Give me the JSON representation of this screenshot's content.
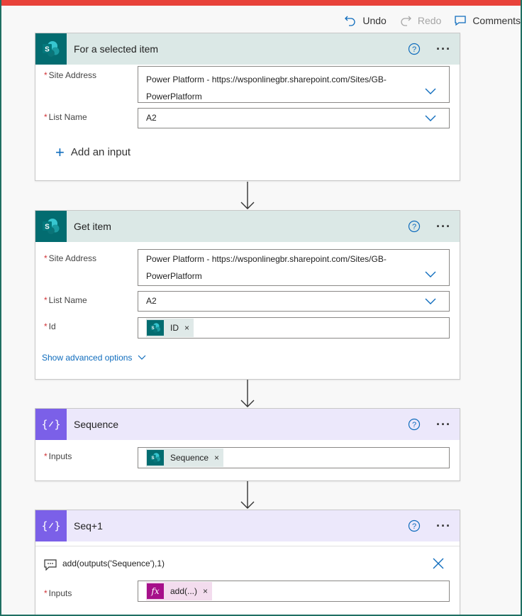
{
  "toolbar": {
    "undo_label": "Undo",
    "redo_label": "Redo",
    "comments_label": "Comments"
  },
  "cards": {
    "trigger": {
      "title": "For a selected item",
      "site_address_label": "Site Address",
      "site_address_line1": "Power Platform - https://wsponlinegbr.sharepoint.com/Sites/GB-",
      "site_address_line2": "PowerPlatform",
      "list_name_label": "List Name",
      "list_name_value": "A2",
      "add_input_label": "Add an input"
    },
    "get_item": {
      "title": "Get item",
      "site_address_label": "Site Address",
      "site_address_line1": "Power Platform - https://wsponlinegbr.sharepoint.com/Sites/GB-",
      "site_address_line2": "PowerPlatform",
      "list_name_label": "List Name",
      "list_name_value": "A2",
      "id_label": "Id",
      "id_token": "ID",
      "advanced_label": "Show advanced options"
    },
    "sequence": {
      "title": "Sequence",
      "inputs_label": "Inputs",
      "inputs_token": "Sequence"
    },
    "seq_plus": {
      "title": "Seq+1",
      "expression": "add(outputs('Sequence'),1)",
      "inputs_label": "Inputs",
      "inputs_token": "add(...)"
    }
  },
  "required_marker": "*",
  "token_remove_glyph": "×",
  "fx_glyph": "fx",
  "more_glyph": "···",
  "colors": {
    "accent_red": "#e8423a",
    "sharepoint_teal": "#036c70",
    "variable_purple": "#7b60e8",
    "expression_magenta": "#a6108a",
    "link_blue": "#0f6cbd"
  }
}
